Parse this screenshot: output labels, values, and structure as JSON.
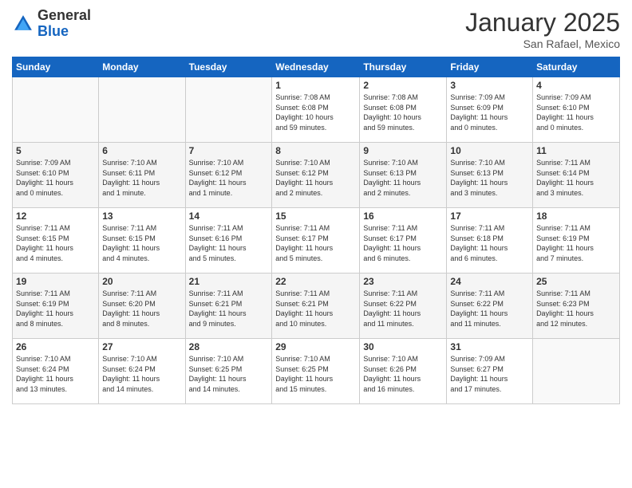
{
  "header": {
    "logo_general": "General",
    "logo_blue": "Blue",
    "month_title": "January 2025",
    "location": "San Rafael, Mexico"
  },
  "days_of_week": [
    "Sunday",
    "Monday",
    "Tuesday",
    "Wednesday",
    "Thursday",
    "Friday",
    "Saturday"
  ],
  "weeks": [
    [
      {
        "num": "",
        "info": ""
      },
      {
        "num": "",
        "info": ""
      },
      {
        "num": "",
        "info": ""
      },
      {
        "num": "1",
        "info": "Sunrise: 7:08 AM\nSunset: 6:08 PM\nDaylight: 10 hours\nand 59 minutes."
      },
      {
        "num": "2",
        "info": "Sunrise: 7:08 AM\nSunset: 6:08 PM\nDaylight: 10 hours\nand 59 minutes."
      },
      {
        "num": "3",
        "info": "Sunrise: 7:09 AM\nSunset: 6:09 PM\nDaylight: 11 hours\nand 0 minutes."
      },
      {
        "num": "4",
        "info": "Sunrise: 7:09 AM\nSunset: 6:10 PM\nDaylight: 11 hours\nand 0 minutes."
      }
    ],
    [
      {
        "num": "5",
        "info": "Sunrise: 7:09 AM\nSunset: 6:10 PM\nDaylight: 11 hours\nand 0 minutes."
      },
      {
        "num": "6",
        "info": "Sunrise: 7:10 AM\nSunset: 6:11 PM\nDaylight: 11 hours\nand 1 minute."
      },
      {
        "num": "7",
        "info": "Sunrise: 7:10 AM\nSunset: 6:12 PM\nDaylight: 11 hours\nand 1 minute."
      },
      {
        "num": "8",
        "info": "Sunrise: 7:10 AM\nSunset: 6:12 PM\nDaylight: 11 hours\nand 2 minutes."
      },
      {
        "num": "9",
        "info": "Sunrise: 7:10 AM\nSunset: 6:13 PM\nDaylight: 11 hours\nand 2 minutes."
      },
      {
        "num": "10",
        "info": "Sunrise: 7:10 AM\nSunset: 6:13 PM\nDaylight: 11 hours\nand 3 minutes."
      },
      {
        "num": "11",
        "info": "Sunrise: 7:11 AM\nSunset: 6:14 PM\nDaylight: 11 hours\nand 3 minutes."
      }
    ],
    [
      {
        "num": "12",
        "info": "Sunrise: 7:11 AM\nSunset: 6:15 PM\nDaylight: 11 hours\nand 4 minutes."
      },
      {
        "num": "13",
        "info": "Sunrise: 7:11 AM\nSunset: 6:15 PM\nDaylight: 11 hours\nand 4 minutes."
      },
      {
        "num": "14",
        "info": "Sunrise: 7:11 AM\nSunset: 6:16 PM\nDaylight: 11 hours\nand 5 minutes."
      },
      {
        "num": "15",
        "info": "Sunrise: 7:11 AM\nSunset: 6:17 PM\nDaylight: 11 hours\nand 5 minutes."
      },
      {
        "num": "16",
        "info": "Sunrise: 7:11 AM\nSunset: 6:17 PM\nDaylight: 11 hours\nand 6 minutes."
      },
      {
        "num": "17",
        "info": "Sunrise: 7:11 AM\nSunset: 6:18 PM\nDaylight: 11 hours\nand 6 minutes."
      },
      {
        "num": "18",
        "info": "Sunrise: 7:11 AM\nSunset: 6:19 PM\nDaylight: 11 hours\nand 7 minutes."
      }
    ],
    [
      {
        "num": "19",
        "info": "Sunrise: 7:11 AM\nSunset: 6:19 PM\nDaylight: 11 hours\nand 8 minutes."
      },
      {
        "num": "20",
        "info": "Sunrise: 7:11 AM\nSunset: 6:20 PM\nDaylight: 11 hours\nand 8 minutes."
      },
      {
        "num": "21",
        "info": "Sunrise: 7:11 AM\nSunset: 6:21 PM\nDaylight: 11 hours\nand 9 minutes."
      },
      {
        "num": "22",
        "info": "Sunrise: 7:11 AM\nSunset: 6:21 PM\nDaylight: 11 hours\nand 10 minutes."
      },
      {
        "num": "23",
        "info": "Sunrise: 7:11 AM\nSunset: 6:22 PM\nDaylight: 11 hours\nand 11 minutes."
      },
      {
        "num": "24",
        "info": "Sunrise: 7:11 AM\nSunset: 6:22 PM\nDaylight: 11 hours\nand 11 minutes."
      },
      {
        "num": "25",
        "info": "Sunrise: 7:11 AM\nSunset: 6:23 PM\nDaylight: 11 hours\nand 12 minutes."
      }
    ],
    [
      {
        "num": "26",
        "info": "Sunrise: 7:10 AM\nSunset: 6:24 PM\nDaylight: 11 hours\nand 13 minutes."
      },
      {
        "num": "27",
        "info": "Sunrise: 7:10 AM\nSunset: 6:24 PM\nDaylight: 11 hours\nand 14 minutes."
      },
      {
        "num": "28",
        "info": "Sunrise: 7:10 AM\nSunset: 6:25 PM\nDaylight: 11 hours\nand 14 minutes."
      },
      {
        "num": "29",
        "info": "Sunrise: 7:10 AM\nSunset: 6:25 PM\nDaylight: 11 hours\nand 15 minutes."
      },
      {
        "num": "30",
        "info": "Sunrise: 7:10 AM\nSunset: 6:26 PM\nDaylight: 11 hours\nand 16 minutes."
      },
      {
        "num": "31",
        "info": "Sunrise: 7:09 AM\nSunset: 6:27 PM\nDaylight: 11 hours\nand 17 minutes."
      },
      {
        "num": "",
        "info": ""
      }
    ]
  ]
}
